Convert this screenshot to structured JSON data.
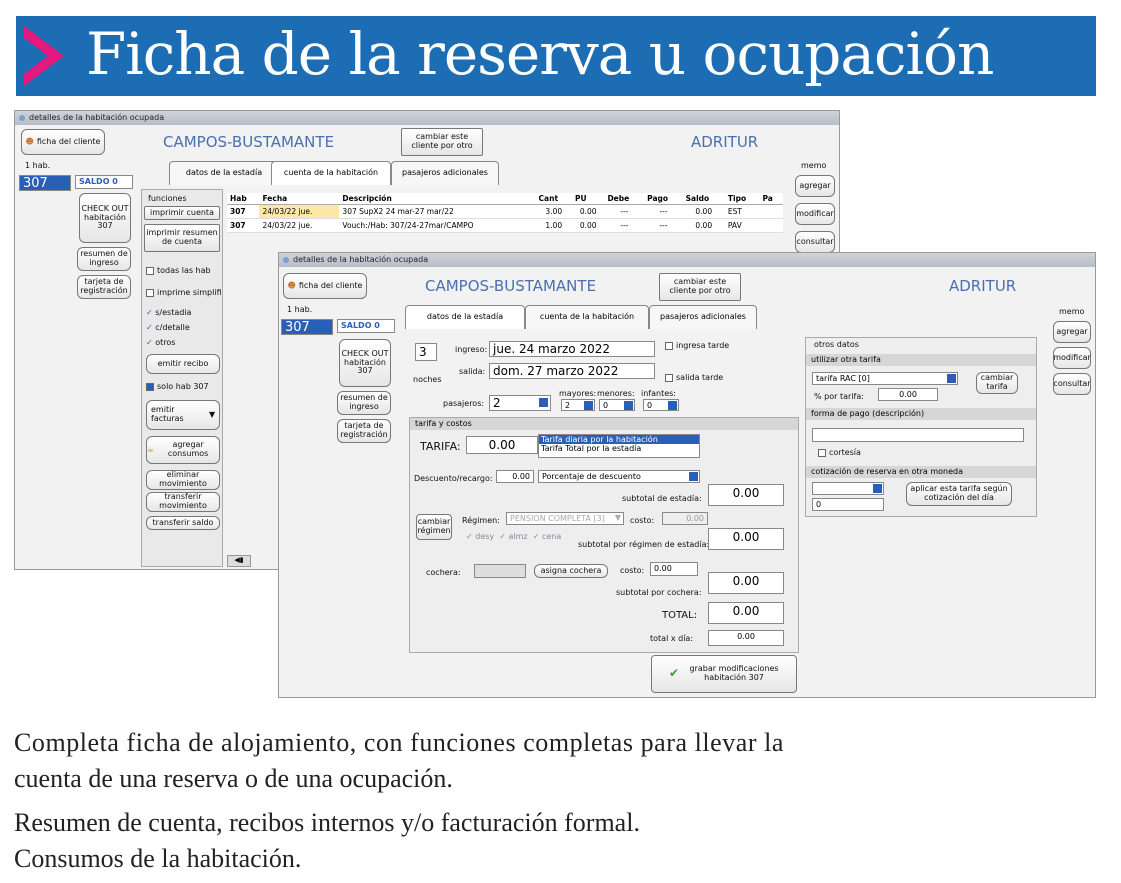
{
  "banner": {
    "title": "Ficha de la reserva u ocupación"
  },
  "back": {
    "title": "detalles de la habitación ocupada",
    "ficha_btn": "ficha del cliente",
    "guest": "CAMPOS-BUSTAMANTE",
    "cambiar": "cambiar este cliente por otro",
    "company": "ADRITUR",
    "hab_label": "1 hab.",
    "room": "307",
    "saldo": "SALDO 0",
    "memo": "memo",
    "agregar": "agregar",
    "modificar": "modificar",
    "consultar": "consultar",
    "tabs": [
      "datos de la estadía",
      "cuenta de la habitación",
      "pasajeros adicionales"
    ],
    "checkout": "CHECK OUT habitación 307",
    "resumen_ingreso": "resumen de ingreso",
    "tarjeta": "tarjeta de registración",
    "funciones": "funciones",
    "imprimir_cuenta": "imprimir cuenta",
    "imprimir_resumen": "imprimir resumen de cuenta",
    "todas": "todas las hab",
    "simplif": "imprime simplifi",
    "s_estadia": "s/estadia",
    "c_detalle": "c/detalle",
    "otros": "otros",
    "emitir_recibo": "emitir recibo",
    "solo_hab": "solo hab 307",
    "emitir_fact": "emitir facturas",
    "agregar_consumos": "agregar consumos",
    "eliminar": "eliminar movimiento",
    "transferir": "transferir movimiento",
    "transferir_saldo": "transferir saldo",
    "columns": [
      "Hab",
      "Fecha",
      "Descripción",
      "Cant",
      "PU",
      "Debe",
      "Pago",
      "Saldo",
      "Tipo",
      "Pa"
    ],
    "rows": [
      [
        "307",
        "24/03/22 jue.",
        "307 SupX2 24 mar-27 mar/22",
        "3.00",
        "0.00",
        "---",
        "---",
        "0.00",
        "EST",
        ""
      ],
      [
        "307",
        "24/03/22 jue.",
        "Vouch:/Hab: 307/24-27mar/CAMPO",
        "1.00",
        "0.00",
        "---",
        "---",
        "0.00",
        "PAV",
        ""
      ]
    ]
  },
  "front": {
    "title": "detalles de la habitación ocupada",
    "ficha_btn": "ficha del cliente",
    "guest": "CAMPOS-BUSTAMANTE",
    "cambiar": "cambiar este cliente por otro",
    "company": "ADRITUR",
    "hab_label": "1 hab.",
    "room": "307",
    "saldo": "SALDO 0",
    "memo": "memo",
    "agregar": "agregar",
    "modificar": "modificar",
    "consultar": "consultar",
    "tabs": [
      "datos de la estadía",
      "cuenta de la habitación",
      "pasajeros adicionales"
    ],
    "checkout": "CHECK OUT habitación 307",
    "resumen_ingreso": "resumen de ingreso",
    "tarjeta": "tarjeta de registración",
    "noches_val": "3",
    "noches": "noches",
    "ingreso_lbl": "ingreso:",
    "ingreso_val": "jue. 24 marzo 2022",
    "salida_lbl": "salida:",
    "salida_val": "dom. 27 marzo 2022",
    "ingresa_tarde": "ingresa tarde",
    "salida_tarde": "salida tarde",
    "pasajeros_lbl": "pasajeros:",
    "pasajeros_val": "2",
    "mayores": "mayores:",
    "menores": "menores:",
    "infantes": "infantes:",
    "mayores_val": "2",
    "menores_val": "0",
    "infantes_val": "0",
    "tarifa_costos": "tarifa y costos",
    "tarifa_lbl": "TARIFA:",
    "tarifa_val": "0.00",
    "tarifa_opts": [
      "Tarifa diaria por la habitación",
      "Tarifa Total por la estadía"
    ],
    "desc_lbl": "Descuento/recargo:",
    "desc_val": "0.00",
    "desc_tipo": "Porcentaje de descuento",
    "sub_estadia_lbl": "subtotal de estadía:",
    "sub_estadia": "0.00",
    "cambiar_regimen": "cambiar régimen",
    "regimen_lbl": "Régimen:",
    "regimen_val": "PENSION COMPLETA [3]",
    "costo_lbl": "costo:",
    "costo_val": "0.00",
    "desy": "desy",
    "almz": "almz",
    "cena": "cena",
    "sub_regimen_lbl": "subtotal por régimen de estadía:",
    "sub_regimen": "0.00",
    "cochera_lbl": "cochera:",
    "asigna_cochera": "asigna cochera",
    "costo2_lbl": "costo:",
    "costo2_val": "0.00",
    "sub_cochera_lbl": "subtotal por cochera:",
    "sub_cochera": "0.00",
    "total_lbl": "TOTAL:",
    "total": "0.00",
    "total_dia_lbl": "total x día:",
    "total_dia": "0.00",
    "grabar": "grabar modificaciones habitación 307",
    "otros_datos": "otros datos",
    "otra_tarifa": "utilizar otra tarifa",
    "tarifa_rac": "tarifa RAC [0]",
    "cambiar_tarifa": "cambiar tarifa",
    "por_tarifa_lbl": "% por tarifa:",
    "por_tarifa": "0.00",
    "forma_pago": "forma de pago (descripción)",
    "cortesia": "cortesía",
    "cotizacion": "cotización de reserva en otra moneda",
    "aplicar": "aplicar esta tarifa según cotización del día",
    "cot_val": "0"
  },
  "captions": [
    "Completa ficha de alojamiento, con funciones completas para llevar la",
    "cuenta de una reserva o de una ocupación.",
    "Resumen de cuenta, recibos internos y/o facturación formal.",
    "Consumos de la habitación."
  ]
}
